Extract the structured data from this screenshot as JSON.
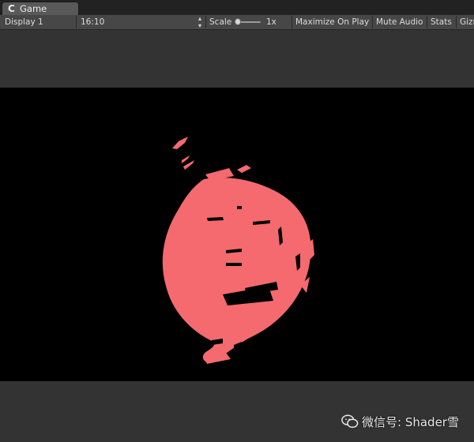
{
  "window": {
    "tab_title": "Game",
    "tab_icon": "unity-game-icon"
  },
  "toolbar": {
    "display": "Display 1",
    "aspect": "16:10",
    "scale_label": "Scale",
    "scale_value": "1x",
    "scale_level": 0,
    "maximize_on_play": "Maximize On Play",
    "mute_audio": "Mute Audio",
    "stats": "Stats",
    "gizmos": "Gizmos"
  },
  "game_view": {
    "background_color": "#000000",
    "render_color": "#f46a6e"
  },
  "watermark": {
    "icon": "wechat-icon",
    "text": "微信号: Shader雪"
  }
}
